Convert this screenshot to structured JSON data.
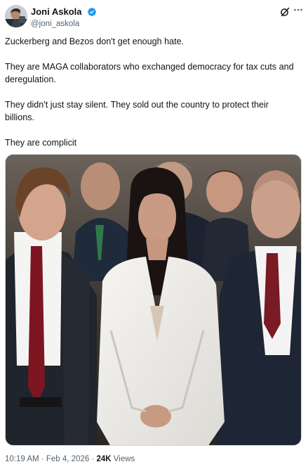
{
  "author": {
    "display_name": "Joni Askola",
    "handle": "@joni_askola",
    "verified": true,
    "verified_color": "#1d9bf0"
  },
  "icons": {
    "verified": "verified-badge-icon",
    "grok": "grok-icon",
    "more": "more-options-icon"
  },
  "tweet": {
    "paragraphs": [
      "Zuckerberg and Bezos don't get enough hate.",
      "They are MAGA collaborators who exchanged democracy for tax cuts and deregulation.",
      "They didn't just stay silent. They sold out the country to protect their billions.",
      "They are complicit"
    ]
  },
  "meta": {
    "time": "10:19 AM",
    "separator": "·",
    "date": "Feb 4, 2026",
    "views_count": "24K",
    "views_label": "Views"
  },
  "colors": {
    "text": "#0f1419",
    "secondary": "#536471",
    "border": "#cfd9de"
  }
}
